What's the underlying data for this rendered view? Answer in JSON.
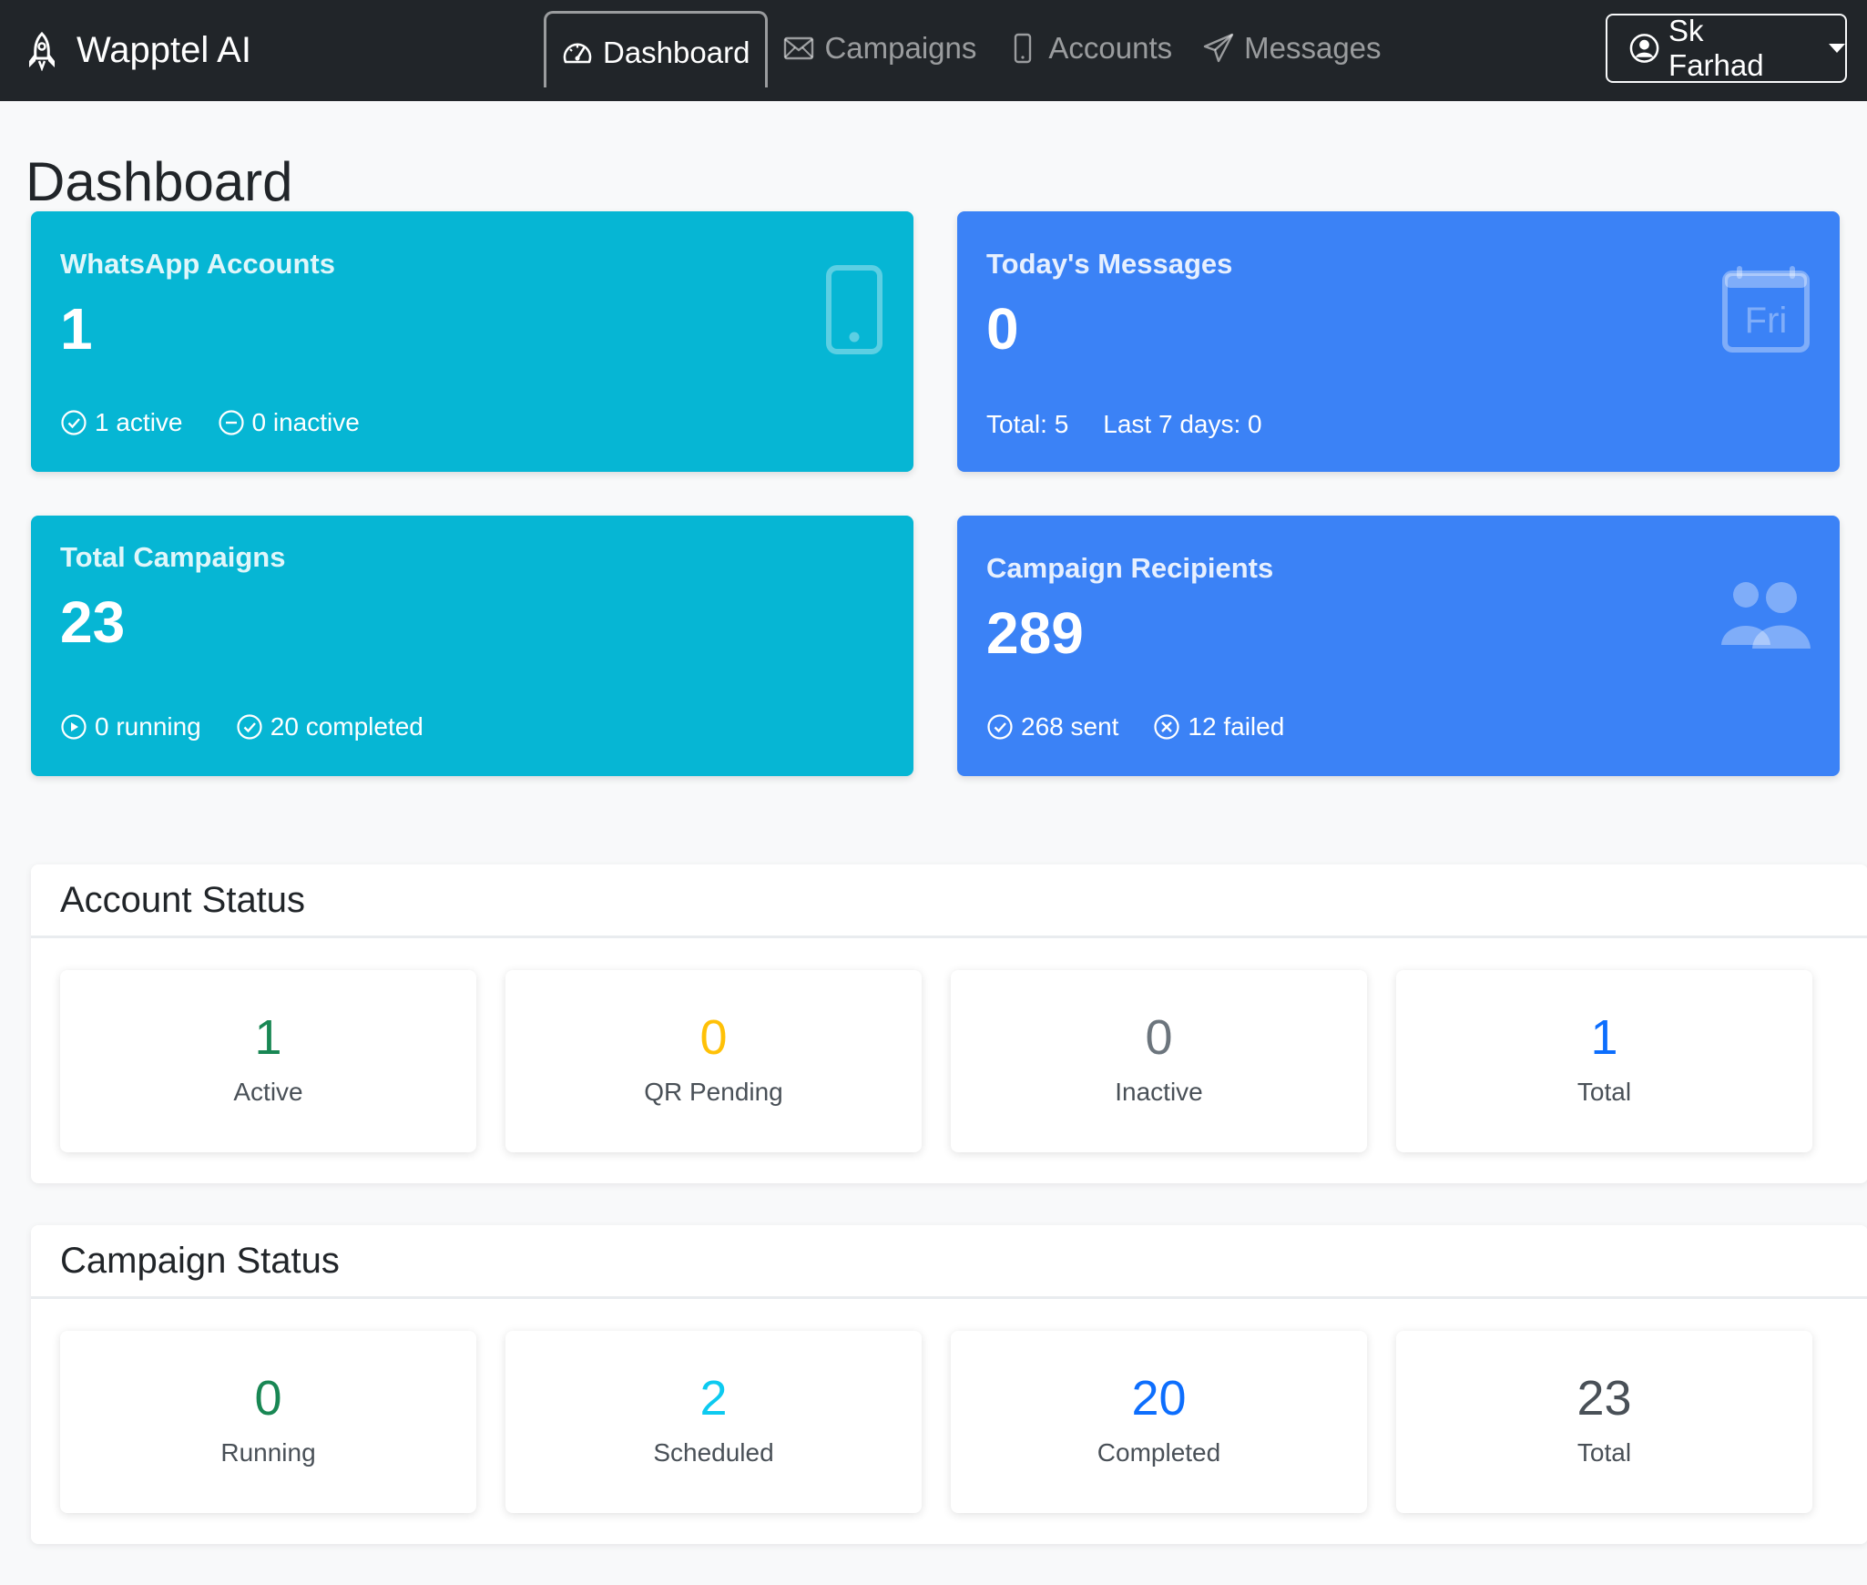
{
  "navbar": {
    "brand": "Wapptel AI",
    "items": [
      {
        "label": "Dashboard",
        "icon": "speedometer-icon",
        "active": true
      },
      {
        "label": "Campaigns",
        "icon": "envelope-icon",
        "active": false
      },
      {
        "label": "Accounts",
        "icon": "phone-icon",
        "active": false
      },
      {
        "label": "Messages",
        "icon": "send-icon",
        "active": false
      }
    ],
    "user": "Sk Farhad"
  },
  "page": {
    "title": "Dashboard"
  },
  "cards": {
    "whatsapp_accounts": {
      "title": "WhatsApp Accounts",
      "value": "1",
      "active": "1 active",
      "inactive": "0 inactive",
      "icon": "phone-icon",
      "color": "#06b6d4"
    },
    "todays_messages": {
      "title": "Today's Messages",
      "value": "0",
      "total": "Total: 5",
      "last7": "Last 7 days: 0",
      "icon": "calendar-icon",
      "icon_text": "Fri",
      "color": "#3b82f6"
    },
    "total_campaigns": {
      "title": "Total Campaigns",
      "value": "23",
      "running": "0 running",
      "completed": "20 completed",
      "color": "#06b6d4"
    },
    "campaign_recipients": {
      "title": "Campaign Recipients",
      "value": "289",
      "sent": "268 sent",
      "failed": "12 failed",
      "icon": "people-icon",
      "color": "#3b82f6"
    }
  },
  "account_status": {
    "title": "Account Status",
    "tiles": [
      {
        "value": "1",
        "label": "Active",
        "color": "#198754"
      },
      {
        "value": "0",
        "label": "QR Pending",
        "color": "#ffc107"
      },
      {
        "value": "0",
        "label": "Inactive",
        "color": "#6c757d"
      },
      {
        "value": "1",
        "label": "Total",
        "color": "#0d6efd"
      }
    ]
  },
  "campaign_status": {
    "title": "Campaign Status",
    "tiles": [
      {
        "value": "0",
        "label": "Running",
        "color": "#198754"
      },
      {
        "value": "2",
        "label": "Scheduled",
        "color": "#0dcaf0"
      },
      {
        "value": "20",
        "label": "Completed",
        "color": "#0d6efd"
      },
      {
        "value": "23",
        "label": "Total",
        "color": "#495057"
      }
    ]
  }
}
